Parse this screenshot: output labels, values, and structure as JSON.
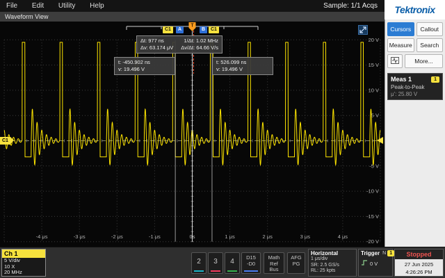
{
  "menu_bar": {
    "items": [
      {
        "label": "File"
      },
      {
        "label": "Edit"
      },
      {
        "label": "Utility"
      },
      {
        "label": "Help"
      }
    ],
    "sample_status": "Sample: 1/1 Acqs"
  },
  "brand": {
    "logo_text": "Tektronix"
  },
  "side_panel": {
    "cursors_button": "Cursors",
    "callout_button": "Callout",
    "measure_button": "Measure",
    "search_button": "Search",
    "more_button": "More...",
    "meas_card": {
      "title": "Meas 1",
      "badge": "1",
      "measure_type": "Peak-to-Peak",
      "value": "μ': 25.80 V"
    }
  },
  "waveform_view": {
    "title": "Waveform View",
    "cursor_readout": {
      "dt": "Δt: 977 ns",
      "inv_dt": "1/Δt: 1.02 MHz",
      "dv": "Δv: 63.174 μV",
      "dv_dt": "Δv/Δt: 64.66 V/s"
    },
    "cursor_a": {
      "t": "t: -450.902 ns",
      "v": "v: 19.496 V"
    },
    "cursor_b": {
      "t": "t: 526.099 ns",
      "v": "v: 19.496 V"
    },
    "top_badges": {
      "c1_left": "C1",
      "a": "A",
      "b": "B",
      "c1_right": "C1"
    },
    "channel_marker": "C1",
    "trigger_flag": "T"
  },
  "plot": {
    "x_ticks": [
      {
        "t": -4,
        "label": "-4 μs"
      },
      {
        "t": -3,
        "label": "-3 μs"
      },
      {
        "t": -2,
        "label": "-2 μs"
      },
      {
        "t": -1,
        "label": "-1 μs"
      },
      {
        "t": 0,
        "label": "0s"
      },
      {
        "t": 1,
        "label": "1 μs"
      },
      {
        "t": 2,
        "label": "2 μs"
      },
      {
        "t": 3,
        "label": "3 μs"
      },
      {
        "t": 4,
        "label": "4 μs"
      }
    ],
    "y_ticks": [
      {
        "v": 20,
        "label": "20 V"
      },
      {
        "v": 15,
        "label": "15 V"
      },
      {
        "v": 10,
        "label": "10 V"
      },
      {
        "v": 5,
        "label": "5 V"
      },
      {
        "v": -5,
        "label": "-5 V"
      },
      {
        "v": -10,
        "label": "-10 V"
      },
      {
        "v": -15,
        "label": "-15 V"
      },
      {
        "v": -20,
        "label": "-20 V"
      }
    ],
    "time_range_us": [
      -5,
      5
    ],
    "volt_range_v": [
      -20,
      20
    ],
    "cursor_a_t_us": -0.4509,
    "cursor_b_t_us": 0.5261,
    "trace_color": "#ffe600",
    "signal": {
      "period_us": 1.0,
      "pulse_start_frac": 0.48,
      "pulse_width_frac": 0.07,
      "high_v": 19.5,
      "low_v": -3.2,
      "flat_frac": 0.17,
      "ring_amp_v": 7.2,
      "ring_cycles": 8,
      "ring_decay": 2.2
    }
  },
  "bottom_bar": {
    "ch1": {
      "label": "Ch 1",
      "scale": "5 V/div",
      "probe": "10 X",
      "bandwidth": "20 MHz"
    },
    "ch2": {
      "label": "2"
    },
    "ch3": {
      "label": "3"
    },
    "ch4": {
      "label": "4"
    },
    "digital": {
      "line1": "D15",
      "line2": "-D0"
    },
    "math": "Math",
    "ref": "Ref",
    "bus": "Bus",
    "afg": "AFG",
    "pg": "PG",
    "horizontal": {
      "title": "Horizontal",
      "scale": "1 μs/div",
      "sample_rate": "SR: 2.5 GS/s",
      "record_length": "RL: 25 kpts"
    },
    "trigger": {
      "title": "Trigger",
      "mode": "N",
      "badge": "1",
      "level": "0 V"
    },
    "acquisition": {
      "status": "Stopped",
      "date": "27 Jun 2025",
      "time": "4:26:26 PM"
    }
  },
  "colors": {
    "accent_yellow": "#f6e13d",
    "cursors_blue": "#2b7cd3",
    "stopped_red": "#ef5350",
    "ch2": "#19b6c9",
    "ch3": "#f23a5e",
    "ch4": "#37b24d",
    "digital": "#4a7df2",
    "trace": "#ffe600"
  }
}
